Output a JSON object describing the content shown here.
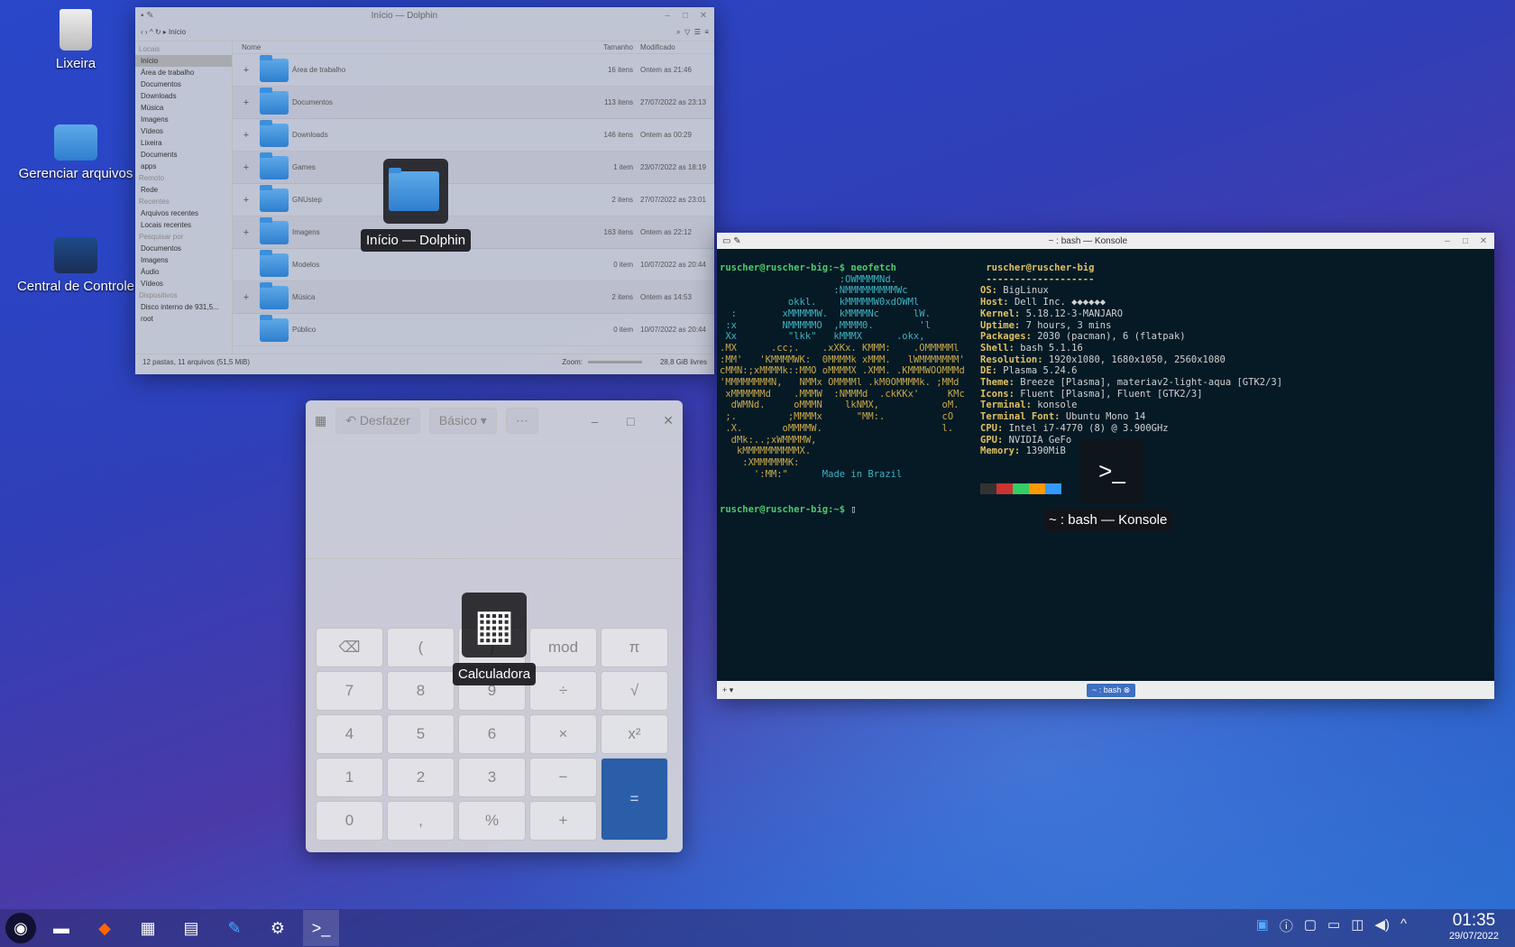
{
  "desktop": {
    "icons": [
      {
        "label": "Lixeira"
      },
      {
        "label": "Gerenciar arquivos"
      },
      {
        "label": "Central de Controle"
      }
    ]
  },
  "dolphin": {
    "title": "Início — Dolphin",
    "path": "Início",
    "sidebar": {
      "sec_places": "Locais",
      "places": [
        "Início",
        "Área de trabalho",
        "Documentos",
        "Downloads",
        "Música",
        "Imagens",
        "Vídeos",
        "Lixeira",
        "Documents",
        "apps"
      ],
      "sec_remote": "Remoto",
      "remote": [
        "Rede"
      ],
      "sec_recent": "Recentes",
      "recent": [
        "Arquivos recentes",
        "Locais recentes"
      ],
      "sec_search": "Pesquisar por",
      "search": [
        "Documentos",
        "Imagens",
        "Áudio",
        "Vídeos"
      ],
      "sec_devices": "Dispositivos",
      "devices": [
        "Disco interno de 931,5...",
        "root"
      ]
    },
    "columns": {
      "name": "Nome",
      "size": "Tamanho",
      "modified": "Modificado"
    },
    "rows": [
      {
        "name": "Área de trabalho",
        "size": "16 itens",
        "modified": "Ontem as 21:46"
      },
      {
        "name": "Documentos",
        "size": "113 itens",
        "modified": "27/07/2022 as 23:13"
      },
      {
        "name": "Downloads",
        "size": "146 itens",
        "modified": "Ontem as 00:29"
      },
      {
        "name": "Games",
        "size": "1 item",
        "modified": "23/07/2022 as 18:19"
      },
      {
        "name": "GNUstep",
        "size": "2 itens",
        "modified": "27/07/2022 as 23:01"
      },
      {
        "name": "Imagens",
        "size": "163 itens",
        "modified": "Ontem as 22:12"
      },
      {
        "name": "Modelos",
        "size": "0 item",
        "modified": "10/07/2022 as 20:44"
      },
      {
        "name": "Música",
        "size": "2 itens",
        "modified": "Ontem as 14:53"
      },
      {
        "name": "Público",
        "size": "0 item",
        "modified": "10/07/2022 as 20:44"
      }
    ],
    "status": "12 pastas, 11 arquivos (51,5 MiB)",
    "zoom": "Zoom:",
    "free": "28,8 GiB livres"
  },
  "overlays": {
    "dolphin": "Início — Dolphin",
    "calc": "Calculadora",
    "konsole": "~ : bash — Konsole"
  },
  "calc": {
    "undo": "Desfazer",
    "mode": "Básico",
    "keys": [
      "⌫",
      "(",
      ")",
      "mod",
      "π",
      "7",
      "8",
      "9",
      "÷",
      "√",
      "4",
      "5",
      "6",
      "×",
      "x²",
      "1",
      "2",
      "3",
      "−",
      "=",
      "0",
      ",",
      "%",
      "+"
    ]
  },
  "konsole": {
    "title": "~ : bash — Konsole",
    "tab": "~ : bash",
    "lines": [
      "ruscher@ruscher-big:~$ neofetch"
    ],
    "info": [
      [
        "",
        "ruscher@ruscher-big"
      ],
      [
        "",
        "-------------------"
      ],
      [
        "OS:",
        "BigLinux"
      ],
      [
        "Host:",
        "Dell Inc. ◆◆◆◆◆◆"
      ],
      [
        "Kernel:",
        "5.18.12-3-MANJARO"
      ],
      [
        "Uptime:",
        "7 hours, 3 mins"
      ],
      [
        "Packages:",
        "2030 (pacman), 6 (flatpak)"
      ],
      [
        "Shell:",
        "bash 5.1.16"
      ],
      [
        "Resolution:",
        "1920x1080, 1680x1050, 2560x1080"
      ],
      [
        "DE:",
        "Plasma 5.24.6"
      ],
      [
        "Theme:",
        "Breeze [Plasma], materiav2-light-aqua [GTK2/3]"
      ],
      [
        "Icons:",
        "Fluent [Plasma], Fluent [GTK2/3]"
      ],
      [
        "Terminal:",
        "konsole"
      ],
      [
        "Terminal Font:",
        "Ubuntu Mono 14"
      ],
      [
        "CPU:",
        "Intel i7-4770 (8) @ 3.900GHz"
      ],
      [
        "GPU:",
        "NVIDIA GeFo"
      ],
      [
        "Memory:",
        "1390MiB"
      ]
    ],
    "made": "Made in Brazil",
    "prompt2": "ruscher@ruscher-big:~$ "
  },
  "taskbar": {
    "time": "01:35",
    "date": "29/07/2022"
  }
}
